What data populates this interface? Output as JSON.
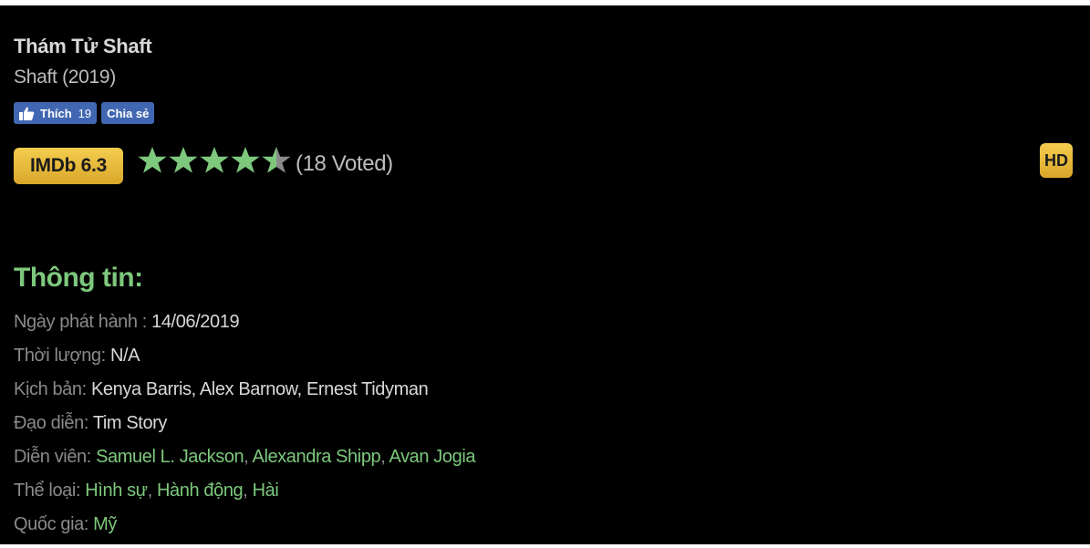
{
  "movie": {
    "title": "Thám Tử Shaft",
    "original_title": "Shaft (2019)"
  },
  "social": {
    "like_label": "Thích",
    "like_count": "19",
    "share_label": "Chia sẻ"
  },
  "rating": {
    "imdb_label": "IMDb 6.3",
    "stars": 4.5,
    "stars_max": 5,
    "votes_text": "(18 Voted)",
    "quality_badge": "HD"
  },
  "info": {
    "heading": "Thông tin:",
    "release_label": "Ngày phát hành : ",
    "release_value": "14/06/2019",
    "duration_label": "Thời lượng: ",
    "duration_value": "N/A",
    "writers_label": "Kịch bản: ",
    "writers_value": "Kenya Barris, Alex Barnow, Ernest Tidyman",
    "director_label": "Đạo diễn: ",
    "director_value": "Tim Story",
    "cast_label": "Diễn viên: ",
    "cast": [
      "Samuel L. Jackson",
      "Alexandra Shipp",
      "Avan Jogia"
    ],
    "genre_label": "Thể loại: ",
    "genres": [
      "Hình sự",
      "Hành động",
      "Hài"
    ],
    "country_label": "Quốc gia: ",
    "country": "Mỹ"
  },
  "colors": {
    "background": "#000000",
    "accent_green": "#7dc87d",
    "gold": "#f4cd4f",
    "facebook_blue": "#4267b2",
    "star_filled": "#7dc87d",
    "star_empty": "#8a8a8a"
  }
}
